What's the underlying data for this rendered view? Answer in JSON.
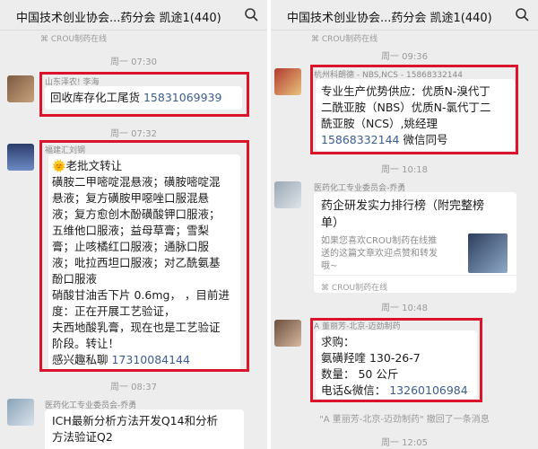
{
  "left": {
    "header_title": "中国技术创业协会...药分会 凯途1(440)",
    "top_source": "CROU制药在线",
    "ts1": "周一 07:30",
    "msg1": {
      "sender": "山东泽农! 李海",
      "text": "回收库存化工尾货 ",
      "phone": "15831069939"
    },
    "ts2": "周一 07:32",
    "msg2": {
      "sender": "福建汇刘钢",
      "emoji": "🌞",
      "lines": [
        "老批文转让",
        "磺胺二甲嘧啶混悬液；磺胺嘧啶混",
        "悬液；复方磺胺甲噁唑口服混悬",
        "液；复方愈创木酚磺酸钾口服液；",
        "五维他口服液；益母草膏；雪梨",
        "膏；止咳橘红口服液；通脉口服",
        "液；吡拉西坦口服液；对乙酰氨基",
        "酚口服液",
        "硝酸甘油舌下片 0.6mg，  ，目前进",
        "度：正在开展工艺验证，",
        "夫西地酸乳膏，现在也是工艺验证",
        "阶段。转让！",
        "感兴趣私聊 "
      ],
      "phone": "17310084144"
    },
    "ts3": "周一 08:37",
    "msg3": {
      "sender": "医药化工专业委员会-乔勇",
      "lines": [
        "ICH最新分析方法开发Q14和分析",
        "方法验证Q2"
      ]
    }
  },
  "right": {
    "header_title": "中国技术创业协会...药分会 凯途1(440)",
    "top_source": "CROU制药在线",
    "ts1": "周一 09:36",
    "msg1": {
      "sender": "杭州科朗德 - NBS,NCS - 15868332144",
      "lines": [
        "专业生产优势供应：优质N-溴代丁",
        "二酰亚胺（NBS）优质N-氯代丁二",
        "酰亚胺（NCS）,姚经理"
      ],
      "phone": "15868332144",
      "tail": " 微信同号"
    },
    "ts2": "周一 10:18",
    "msg2": {
      "sender": "医药化工专业委员会-乔勇",
      "title_lines": [
        "药企研发实力排行榜（附完整榜",
        "单）"
      ],
      "desc_lines": [
        "如果您喜欢CROU制药在线推",
        "送的这篇文章欢迎点赞和转发",
        "哦~"
      ],
      "source": "CROU制药在线"
    },
    "ts3": "周一 10:48",
    "msg3": {
      "sender": "A 董丽芳-北京-迈劲制药",
      "lines": [
        "求购：",
        "氨磺羟喹 130-26-7",
        "数量： 50 公斤",
        "电话&微信： "
      ],
      "phone": "13260106984"
    },
    "system_notice": "\"A 董丽芳-北京-迈劲制药\" 撤回了一条消息",
    "ts4": "周一 12:05"
  }
}
